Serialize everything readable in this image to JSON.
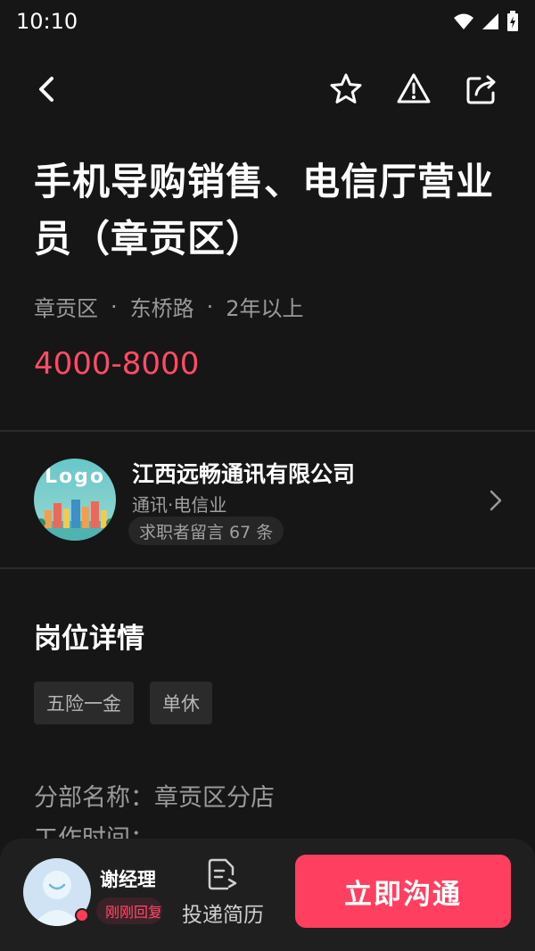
{
  "status_bar": {
    "time": "10:10"
  },
  "job": {
    "title": "手机导购销售、电信厅营业员（章贡区）",
    "district": "章贡区",
    "street": "东桥路",
    "experience": "2年以上",
    "separator": "·",
    "salary": "4000-8000"
  },
  "company": {
    "logo_text": "Logo",
    "name": "江西远畅通讯有限公司",
    "industry": "通讯·电信业",
    "messages": "求职者留言 67 条"
  },
  "details": {
    "section_title": "岗位详情",
    "tags": [
      "五险一金",
      "单休"
    ],
    "lines": [
      "分部名称：章贡区分店",
      "工作时间："
    ]
  },
  "bottom": {
    "hr_name": "谢经理",
    "hr_status": "刚刚回复",
    "resume_label": "投递简历",
    "chat_label": "立即沟通"
  },
  "icons": [
    "back-icon",
    "star-icon",
    "warning-icon",
    "share-icon",
    "chevron-right-icon",
    "resume-icon"
  ],
  "colors": {
    "accent": "#ff3f5f",
    "salary": "#ff4b66",
    "background": "#161616"
  }
}
